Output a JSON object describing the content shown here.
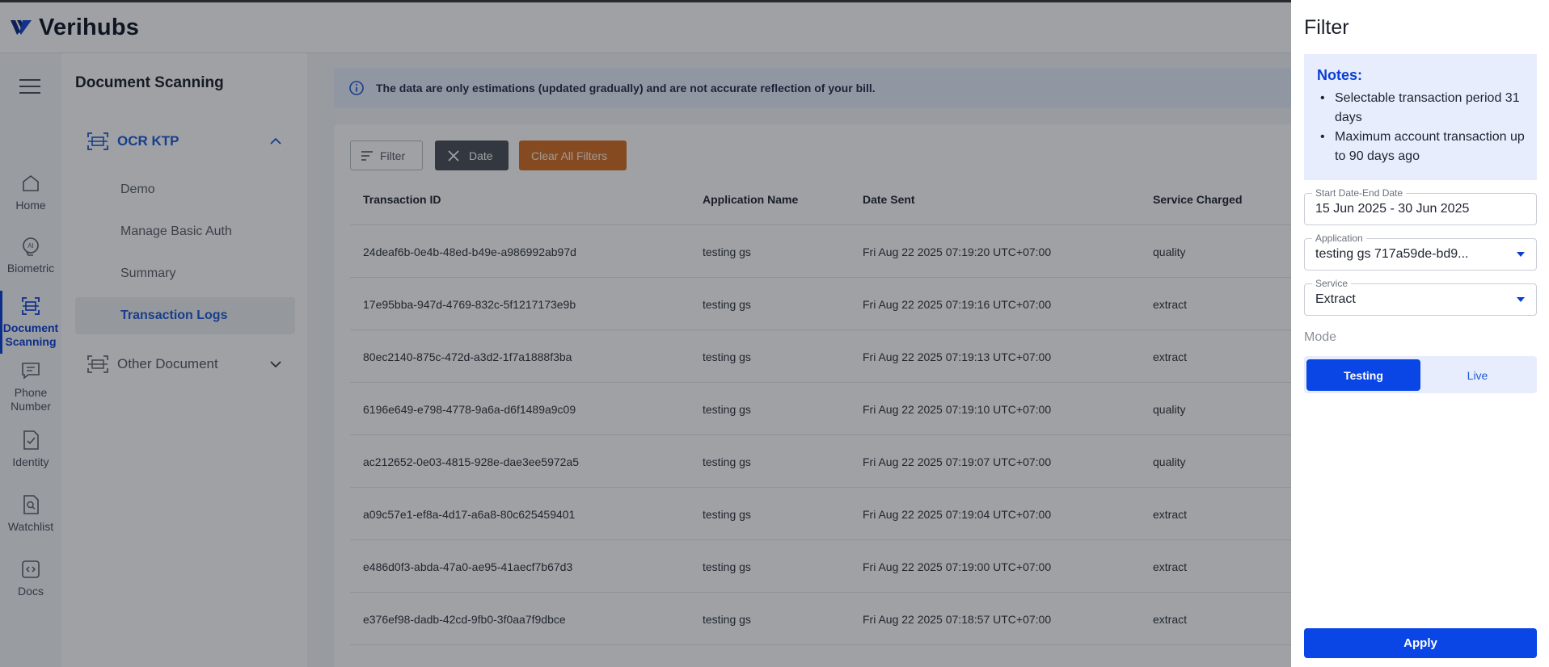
{
  "app": {
    "name": "Verihubs"
  },
  "rail": {
    "items": [
      {
        "label": "Home",
        "icon": "home-icon"
      },
      {
        "label": "Biometric",
        "icon": "biometric-icon"
      },
      {
        "label": "Document Scanning",
        "icon": "document-scan-icon"
      },
      {
        "label": "Phone Number",
        "icon": "chat-icon"
      },
      {
        "label": "Identity",
        "icon": "identity-check-icon"
      },
      {
        "label": "Watchlist",
        "icon": "watchlist-search-icon"
      },
      {
        "label": "Docs",
        "icon": "code-icon"
      }
    ]
  },
  "subnav": {
    "title": "Document Scanning",
    "groups": [
      {
        "label": "OCR KTP",
        "expanded": true
      },
      {
        "label": "Other Document",
        "expanded": false
      }
    ],
    "items": [
      {
        "label": "Demo"
      },
      {
        "label": "Manage Basic Auth"
      },
      {
        "label": "Summary"
      },
      {
        "label": "Transaction Logs",
        "active": true
      }
    ]
  },
  "banner": {
    "text": "The data are only estimations (updated gradually) and are not accurate reflection of your bill."
  },
  "toolbar": {
    "filter_label": "Filter",
    "date_label": "Date",
    "clear_label": "Clear All Filters"
  },
  "table": {
    "headers": [
      "Transaction ID",
      "Application Name",
      "Date Sent",
      "Service Charged"
    ],
    "rows": [
      {
        "id": "24deaf6b-0e4b-48ed-b49e-a986992ab97d",
        "app": "testing gs",
        "date": "Fri Aug 22 2025 07:19:20 UTC+07:00",
        "service": "quality"
      },
      {
        "id": "17e95bba-947d-4769-832c-5f1217173e9b",
        "app": "testing gs",
        "date": "Fri Aug 22 2025 07:19:16 UTC+07:00",
        "service": "extract"
      },
      {
        "id": "80ec2140-875c-472d-a3d2-1f7a1888f3ba",
        "app": "testing gs",
        "date": "Fri Aug 22 2025 07:19:13 UTC+07:00",
        "service": "extract"
      },
      {
        "id": "6196e649-e798-4778-9a6a-d6f1489a9c09",
        "app": "testing gs",
        "date": "Fri Aug 22 2025 07:19:10 UTC+07:00",
        "service": "quality"
      },
      {
        "id": "ac212652-0e03-4815-928e-dae3ee5972a5",
        "app": "testing gs",
        "date": "Fri Aug 22 2025 07:19:07 UTC+07:00",
        "service": "quality"
      },
      {
        "id": "a09c57e1-ef8a-4d17-a6a8-80c625459401",
        "app": "testing gs",
        "date": "Fri Aug 22 2025 07:19:04 UTC+07:00",
        "service": "extract"
      },
      {
        "id": "e486d0f3-abda-47a0-ae95-41aecf7b67d3",
        "app": "testing gs",
        "date": "Fri Aug 22 2025 07:19:00 UTC+07:00",
        "service": "extract"
      },
      {
        "id": "e376ef98-dadb-42cd-9fb0-3f0aa7f9dbce",
        "app": "testing gs",
        "date": "Fri Aug 22 2025 07:18:57 UTC+07:00",
        "service": "extract"
      }
    ]
  },
  "drawer": {
    "title": "Filter",
    "notes_title": "Notes:",
    "notes": [
      "Selectable transaction period 31 days",
      "Maximum account transaction up to 90 days ago"
    ],
    "date_range": {
      "label": "Start Date-End Date",
      "value": "15 Jun 2025 - 30 Jun 2025"
    },
    "application": {
      "label": "Application",
      "value": "testing gs 717a59de-bd9..."
    },
    "service": {
      "label": "Service",
      "value": "Extract"
    },
    "mode": {
      "label": "Mode",
      "options": [
        "Testing",
        "Live"
      ],
      "selected": "Testing"
    },
    "apply_label": "Apply"
  },
  "colors": {
    "accent": "#0a46e6",
    "link": "#1f5bd6",
    "clear_button": "#d56f25",
    "date_chip": "#4b4f57",
    "banner_bg": "#e7eefc"
  }
}
